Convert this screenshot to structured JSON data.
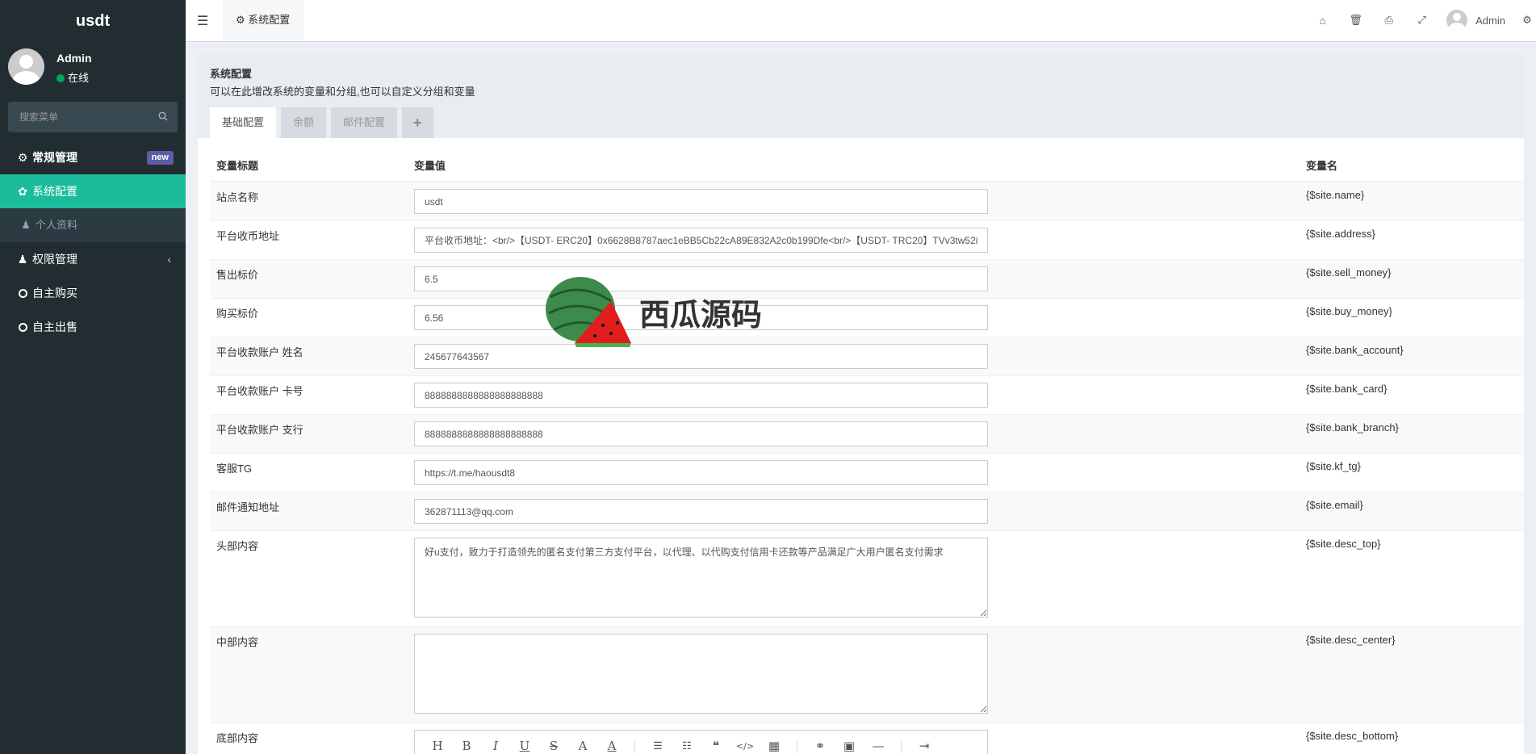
{
  "app": {
    "logo": "usdt"
  },
  "user": {
    "name": "Admin",
    "status": "在线"
  },
  "search": {
    "placeholder": "搜索菜单"
  },
  "menu": {
    "items": [
      {
        "label": "常规管理",
        "badge": "new"
      },
      {
        "label": "系统配置"
      },
      {
        "label": "个人资料"
      },
      {
        "label": "权限管理"
      },
      {
        "label": "自主购买"
      },
      {
        "label": "自主出售"
      }
    ]
  },
  "topbar": {
    "tab": "系统配置",
    "user": "Admin"
  },
  "panel": {
    "title": "系统配置",
    "desc": "可以在此增改系统的变量和分组,也可以自定义分组和变量"
  },
  "tabs": [
    "基础配置",
    "余额",
    "邮件配置",
    "+"
  ],
  "table": {
    "headers": [
      "变量标题",
      "变量值",
      "变量名"
    ],
    "rows": [
      {
        "label": "站点名称",
        "value": "usdt",
        "var": "{$site.name}"
      },
      {
        "label": "平台收币地址",
        "value": "平台收币地址：<br/>【USDT- ERC20】0x6628B8787aec1eBB5Cb22cA89E832A2c0b199Dfe<br/>【USDT- TRC20】TVv3tw52i",
        "var": "{$site.address}"
      },
      {
        "label": "售出标价",
        "value": "6.5",
        "var": "{$site.sell_money}"
      },
      {
        "label": "购买标价",
        "value": "6.56",
        "var": "{$site.buy_money}"
      },
      {
        "label": "平台收款账户 姓名",
        "value": "245677643567",
        "var": "{$site.bank_account}"
      },
      {
        "label": "平台收款账户 卡号",
        "value": "8888888888888888888888",
        "var": "{$site.bank_card}"
      },
      {
        "label": "平台收款账户 支行",
        "value": "8888888888888888888888",
        "var": "{$site.bank_branch}"
      },
      {
        "label": "客服TG",
        "value": "https://t.me/haousdt8",
        "var": "{$site.kf_tg}"
      },
      {
        "label": "邮件通知地址",
        "value": "362871113@qq.com",
        "var": "{$site.email}"
      },
      {
        "label": "头部内容",
        "value": "好u支付，致力于打造领先的匿名支付第三方支付平台，以代理、以代购支付信用卡还款等产品满足广大用户匿名支付需求",
        "var": "{$site.desc_top}"
      },
      {
        "label": "中部内容",
        "value": "",
        "var": "{$site.desc_center}"
      },
      {
        "label": "底部内容",
        "value": "",
        "var": "{$site.desc_bottom}"
      }
    ]
  },
  "editor": {
    "buttons": [
      "H",
      "B",
      "I",
      "U",
      "S",
      "A",
      "A"
    ]
  },
  "watermark": {
    "text": "西瓜源码"
  },
  "colors": {
    "sidebar": "#222d32",
    "active": "#1bbc9b",
    "badge": "#605ca8",
    "online": "#00a65a"
  }
}
